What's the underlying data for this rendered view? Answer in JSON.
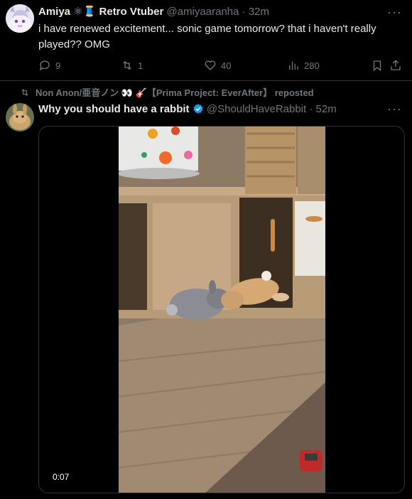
{
  "tweet1": {
    "author_name": "Amiya",
    "author_name_suffix": "Retro Vtuber",
    "emoji_atom": "⚛",
    "emoji_spool": "🧵",
    "handle": "@amiyaaranha",
    "dot": "·",
    "time": "32m",
    "text": "i have renewed excitement... sonic game tomorrow? that i haven't really played?? OMG",
    "replies": "9",
    "retweets": "1",
    "likes": "40",
    "views": "280",
    "more": "···"
  },
  "repost": {
    "label": "Non Anon/亜音ノン 👀 🎸【Prima Project: EverAfter】 reposted"
  },
  "tweet2": {
    "author_name": "Why you should have a rabbit",
    "handle": "@ShouldHaveRabbit",
    "dot": "·",
    "time": "52m",
    "more": "···",
    "video_time": "0:07"
  },
  "colors": {
    "background": "#000000",
    "text": "#e7e9ea",
    "muted": "#71767b",
    "verified": "#1d9bf0",
    "border": "#2f3336"
  }
}
